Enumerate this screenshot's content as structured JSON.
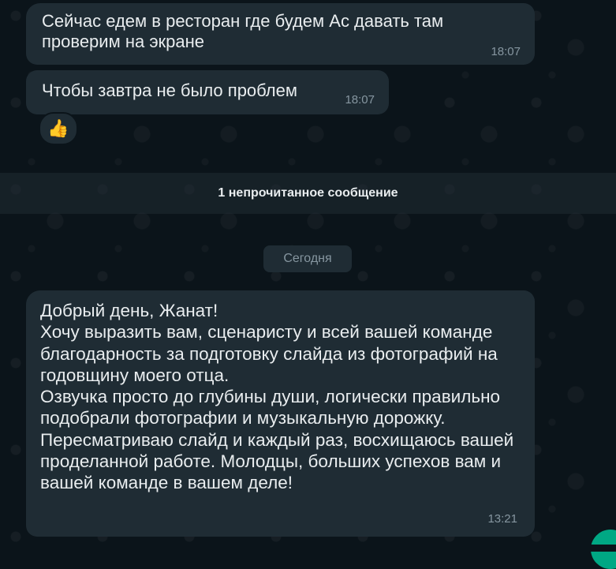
{
  "messages": [
    {
      "text": "Сейчас едем в ресторан где будем Ас давать там проверим на экране",
      "time": "18:07"
    },
    {
      "text": "Чтобы завтра не было проблем",
      "time": "18:07",
      "reaction": "👍"
    },
    {
      "text": "Добрый день, Жанат!\nХочу выразить вам, сценаристу и всей вашей команде благодарность за подготовку слайда из фотографий на годовщину моего отца.\nОзвучка просто до глубины души, логически правильно подобрали фотографии и музыкальную дорожку. Пересматриваю слайд и каждый раз, восхищаюсь вашей проделанной работе. Молодцы, больших успехов вам и вашей команде в вашем деле!",
      "time": "13:21"
    }
  ],
  "unread_banner": "1 непрочитанное сообщение",
  "date_divider": "Сегодня",
  "colors": {
    "background": "#0b141a",
    "bubble": "#1f2c34",
    "text": "#e9edef",
    "meta": "#8696a0",
    "accent": "#00a884"
  }
}
